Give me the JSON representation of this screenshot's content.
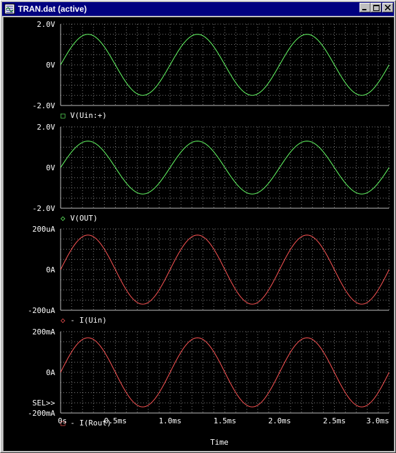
{
  "window": {
    "title": "TRAN.dat (active)",
    "icon": "probe-window-icon",
    "controls": [
      "minimize-icon",
      "maximize-icon",
      "close-icon"
    ]
  },
  "colors": {
    "background": "#000000",
    "grid": "#808080",
    "axis_text": "#ffffff",
    "legend_text": "#ffffff",
    "voltage_trace": "#66ff66",
    "current_trace": "#ff5555"
  },
  "x_axis": {
    "label": "Time",
    "ticks": [
      "0s",
      "0.5ms",
      "1.0ms",
      "1.5ms",
      "2.0ms",
      "2.5ms",
      "3.0ms"
    ],
    "tick_values_ms": [
      0,
      0.5,
      1.0,
      1.5,
      2.0,
      2.5,
      3.0
    ],
    "range_ms": [
      0,
      3.0
    ]
  },
  "sel_marker": "SEL>>",
  "chart_data": [
    {
      "type": "line",
      "ylim": [
        -2.0,
        2.0
      ],
      "y_ticks": [
        "2.0V",
        "0V",
        "-2.0V"
      ],
      "legend": {
        "marker": "□",
        "label": "V(Uin:+)"
      },
      "series": [
        {
          "name": "V(Uin:+)",
          "color": "#66ff66",
          "amplitude": 1.5,
          "frequency_hz": 1000,
          "phase_deg": 0
        }
      ]
    },
    {
      "type": "line",
      "ylim": [
        -2.0,
        2.0
      ],
      "y_ticks": [
        "2.0V",
        "0V",
        "-2.0V"
      ],
      "legend": {
        "marker": "◇",
        "label": "V(OUT)"
      },
      "series": [
        {
          "name": "V(OUT)",
          "color": "#66ff66",
          "amplitude": 1.3,
          "frequency_hz": 1000,
          "phase_deg": 0
        }
      ]
    },
    {
      "type": "line",
      "ylim": [
        -200,
        200
      ],
      "y_ticks": [
        "200uA",
        "0A",
        "-200uA"
      ],
      "legend": {
        "marker": "◇",
        "label": "- I(Uin)"
      },
      "series": [
        {
          "name": "- I(Uin)",
          "color": "#ff5555",
          "amplitude": 170,
          "frequency_hz": 1000,
          "phase_deg": 0
        }
      ]
    },
    {
      "type": "line",
      "ylim": [
        -200,
        200
      ],
      "y_ticks": [
        "200mA",
        "0A",
        "-200mA"
      ],
      "legend": {
        "marker": "□",
        "label": "- I(Rout)"
      },
      "series": [
        {
          "name": "- I(Rout)",
          "color": "#ff5555",
          "amplitude": 170,
          "frequency_hz": 1000,
          "phase_deg": 0
        }
      ]
    }
  ]
}
